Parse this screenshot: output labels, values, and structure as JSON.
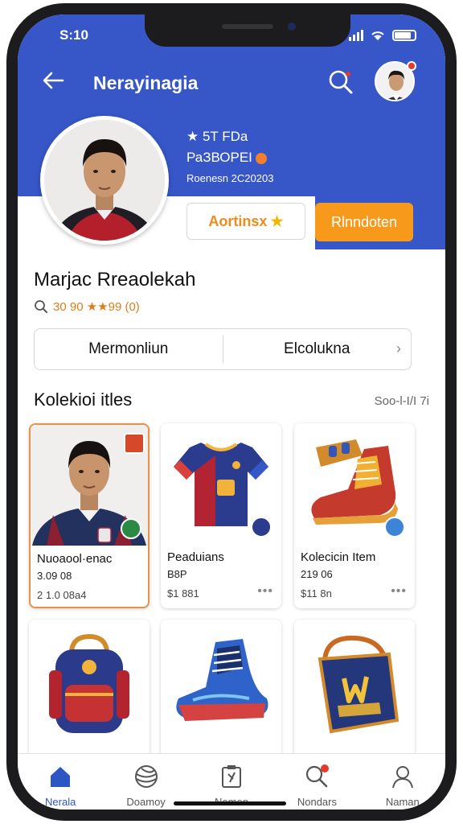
{
  "status": {
    "time": "S:10"
  },
  "header": {
    "title": "Nerayinagia"
  },
  "profile": {
    "stat1": "★ 5T FDa",
    "stat2": "РаЗВОРЕI",
    "stat3": "Roenesn 2С20203",
    "follow_label": "Aortinsх",
    "follow_star": "★",
    "message_label": "Rlnndoten",
    "name": "Marjac Rreaolekah",
    "rating_text": "30 90 ★★99 (0)"
  },
  "segments": {
    "left": "Mermonliun",
    "right": "Elcolukna"
  },
  "section": {
    "title": "Kolekioi itles",
    "link": "Soo-l-I/I 7i"
  },
  "cards": [
    {
      "title": "Nuoaool·enac",
      "sub": "3.09 08",
      "price": "2 1.0 08a4"
    },
    {
      "title": "Peaduians",
      "sub": "B8P",
      "price": "$1 881"
    },
    {
      "title": "Kolecicin Item",
      "sub": "219 06",
      "price": "$11 8n"
    },
    {
      "title": "",
      "sub": "",
      "price": ""
    },
    {
      "title": "",
      "sub": "",
      "price": ""
    },
    {
      "title": "",
      "sub": "",
      "price": ""
    }
  ],
  "nav": [
    {
      "label": "Nerala",
      "icon": "home-icon",
      "active": true
    },
    {
      "label": "Doamoy",
      "icon": "globe-icon"
    },
    {
      "label": "Namen",
      "icon": "tag-icon"
    },
    {
      "label": "Nondars",
      "icon": "search-icon"
    },
    {
      "label": "Naman",
      "icon": "profile-icon"
    }
  ],
  "colors": {
    "header_blue": "#3757c8",
    "accent_orange": "#f79a1b",
    "active_nav": "#2c56c6"
  }
}
